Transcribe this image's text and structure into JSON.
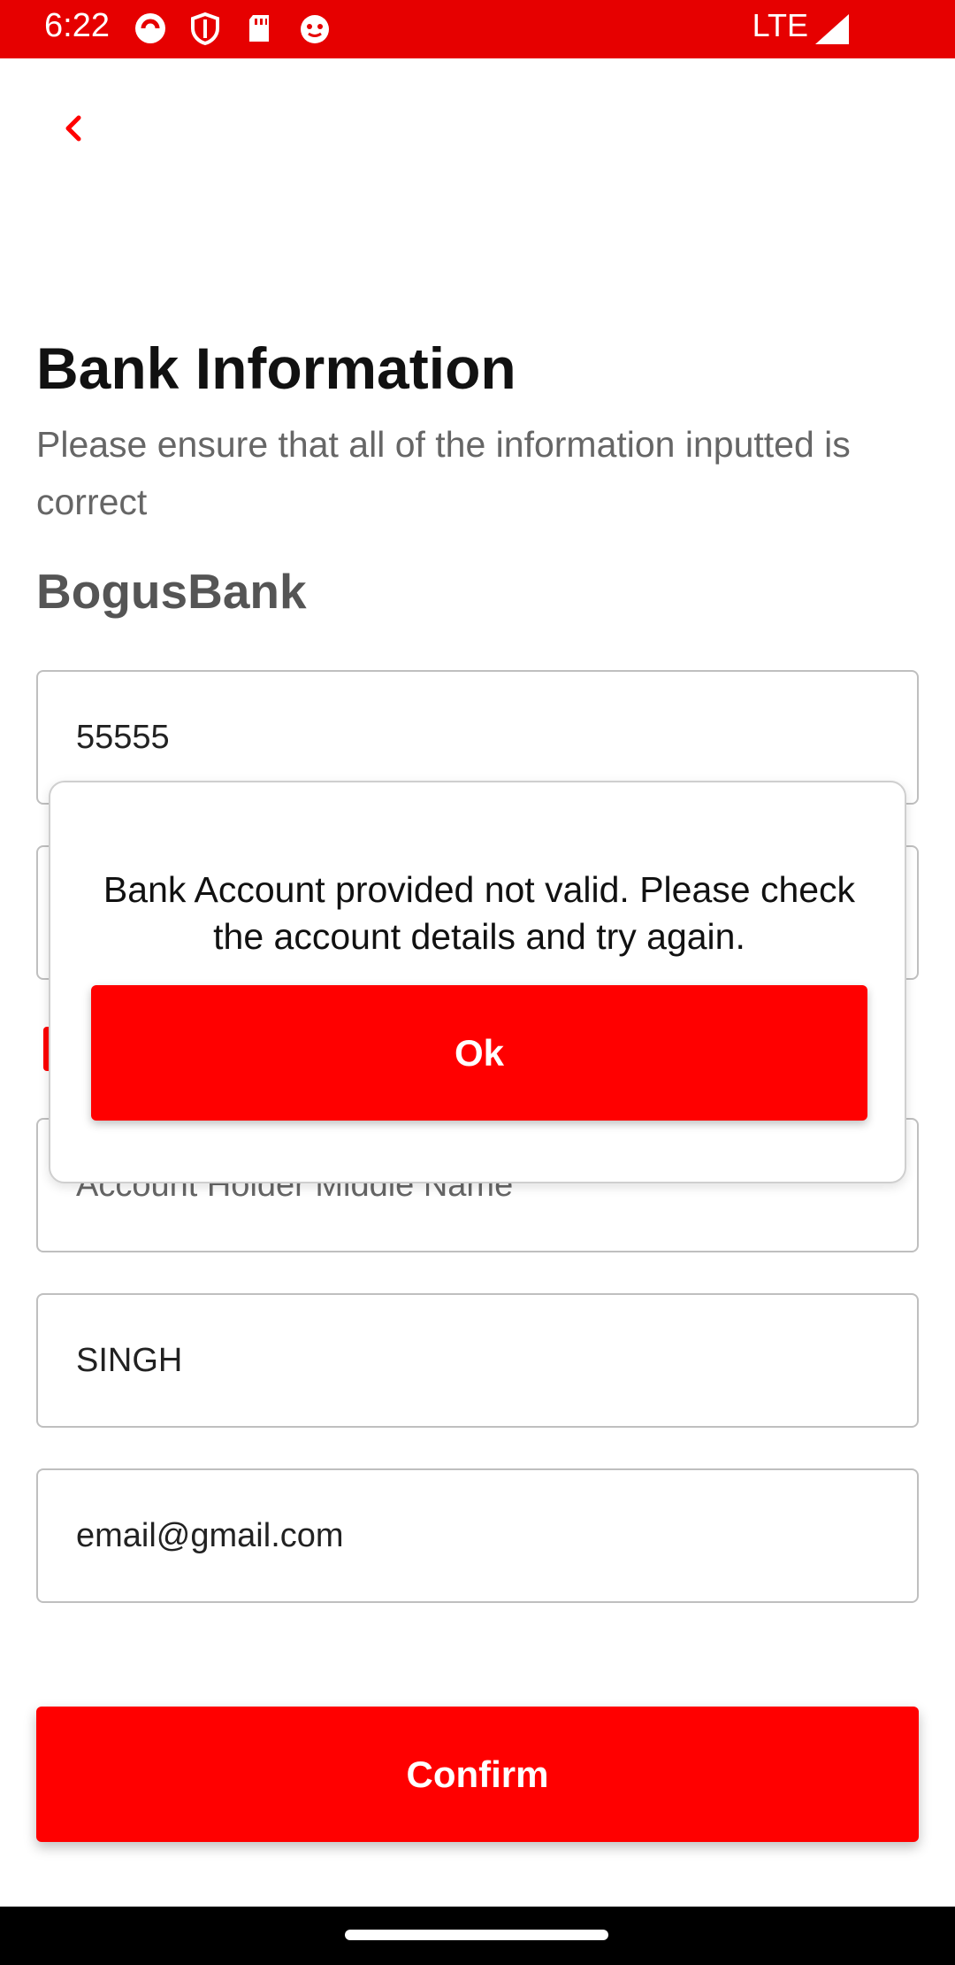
{
  "status_bar": {
    "time": "6:22",
    "network": "LTE",
    "icons": [
      "app-icon-1",
      "shield-icon",
      "sd-card-icon",
      "app-icon-2"
    ],
    "color": "#e60000"
  },
  "header": {
    "title": "Bank Information",
    "subtitle": "Please ensure that all of the information inputted is correct",
    "bank_name": "BogusBank"
  },
  "form": {
    "account_number": "55555",
    "middle_name_placeholder": "Account Holder Middle Name",
    "last_name": "SINGH",
    "email": "email@gmail.com",
    "confirm_label": "Confirm"
  },
  "dialog": {
    "message": "Bank Account provided not valid. Please check the account details and try again.",
    "ok_label": "Ok"
  },
  "colors": {
    "accent": "#ff0000",
    "status_bar": "#e60000"
  }
}
